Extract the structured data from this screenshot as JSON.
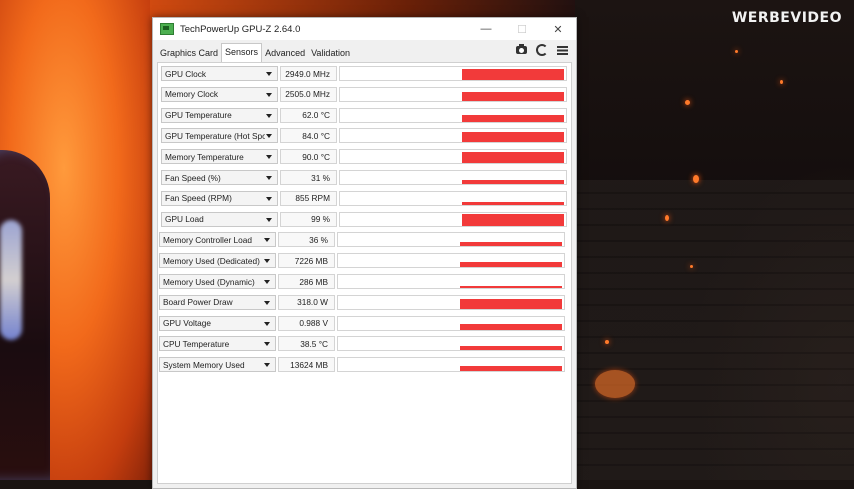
{
  "watermark": "WERBEVIDEO",
  "window": {
    "title": "TechPowerUp GPU-Z 2.64.0",
    "controls": {
      "minimize": "—",
      "maximize": "☐",
      "close": "✕"
    }
  },
  "tabs": [
    {
      "label": "Graphics Card",
      "active": false
    },
    {
      "label": "Sensors",
      "active": true
    },
    {
      "label": "Advanced",
      "active": false
    },
    {
      "label": "Validation",
      "active": false
    }
  ],
  "toolbar_icons": [
    "camera-icon",
    "refresh-icon",
    "menu-icon"
  ],
  "sensors": [
    {
      "label": "GPU Clock",
      "value": "2949.0 MHz",
      "level": 0.95
    },
    {
      "label": "Memory Clock",
      "value": "2505.0 MHz",
      "level": 0.75
    },
    {
      "label": "GPU Temperature",
      "value": "62.0 °C",
      "level": 0.62
    },
    {
      "label": "GPU Temperature (Hot Spot)",
      "value": "84.0 °C",
      "level": 0.84
    },
    {
      "label": "Memory Temperature",
      "value": "90.0 °C",
      "level": 0.9
    },
    {
      "label": "Fan Speed (%)",
      "value": "31 %",
      "level": 0.31
    },
    {
      "label": "Fan Speed (RPM)",
      "value": "855 RPM",
      "level": 0.25
    },
    {
      "label": "GPU Load",
      "value": "99 %",
      "level": 0.99
    },
    {
      "label": "Memory Controller Load",
      "value": "36 %",
      "level": 0.36
    },
    {
      "label": "Memory Used (Dedicated)",
      "value": "7226 MB",
      "level": 0.44
    },
    {
      "label": "Memory Used (Dynamic)",
      "value": "286 MB",
      "level": 0.1
    },
    {
      "label": "Board Power Draw",
      "value": "318.0 W",
      "level": 0.85
    },
    {
      "label": "GPU Voltage",
      "value": "0.988 V",
      "level": 0.5
    },
    {
      "label": "CPU Temperature",
      "value": "38.5 °C",
      "level": 0.3
    },
    {
      "label": "System Memory Used",
      "value": "13624 MB",
      "level": 0.42
    }
  ],
  "colors": {
    "graph": "#f23a3a",
    "window_bg": "#f0f0f0",
    "accent": "#4caf50"
  }
}
